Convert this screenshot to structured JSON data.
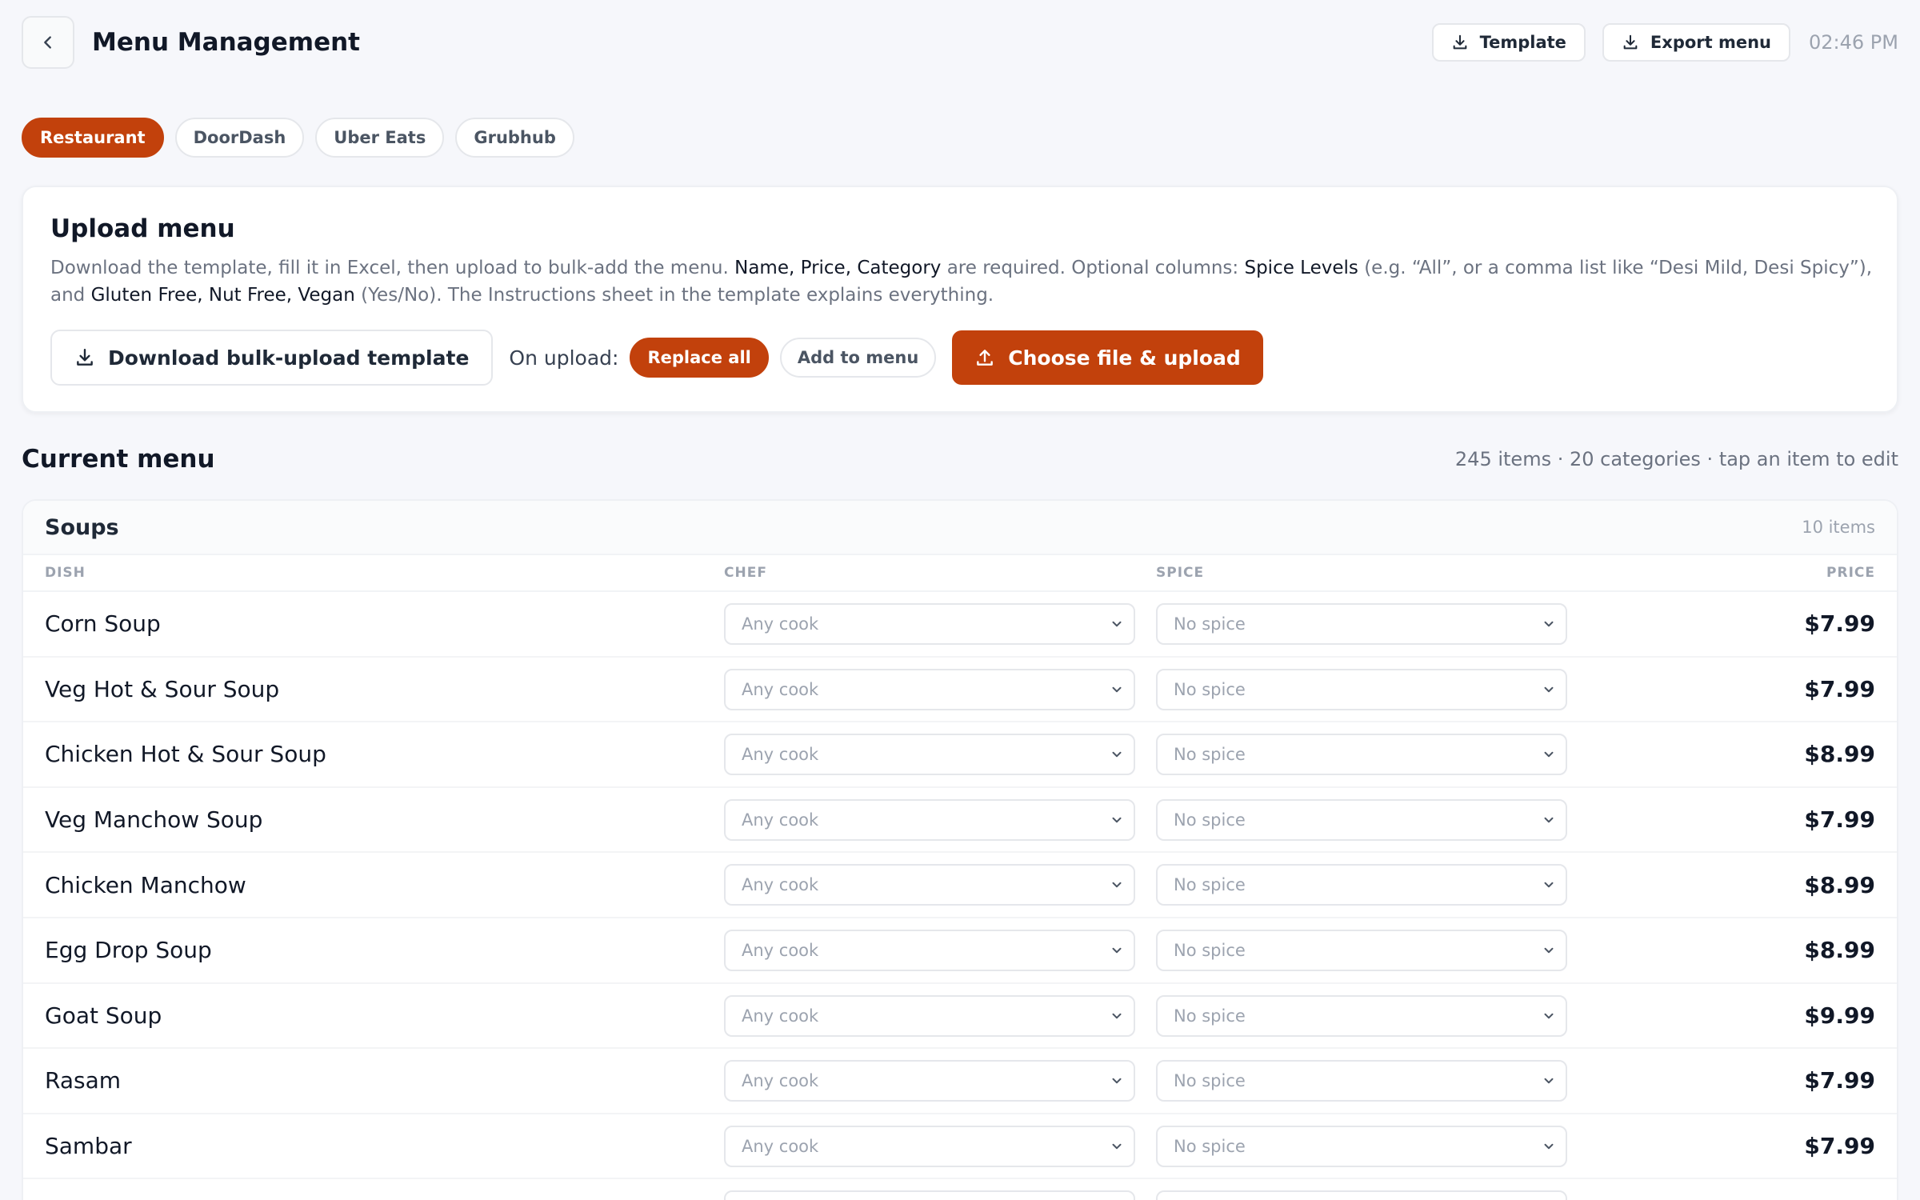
{
  "header": {
    "title": "Menu Management",
    "template_label": "Template",
    "export_label": "Export menu",
    "time": "02:46 PM"
  },
  "tabs": [
    {
      "label": "Restaurant",
      "active": true
    },
    {
      "label": "DoorDash",
      "active": false
    },
    {
      "label": "Uber Eats",
      "active": false
    },
    {
      "label": "Grubhub",
      "active": false
    }
  ],
  "upload": {
    "title": "Upload menu",
    "desc_1": "Download the template, fill it in Excel, then upload to bulk-add the menu. ",
    "desc_required": "Name, Price, Category",
    "desc_2": " are required. Optional columns: ",
    "desc_spice": "Spice Levels",
    "desc_3": " (e.g. “All”, or a comma list like “Desi Mild, Desi Spicy”), and ",
    "desc_flags": "Gluten Free, Nut Free, Vegan",
    "desc_4": " (Yes/No). The Instructions sheet in the template explains everything.",
    "download_label": "Download bulk-upload template",
    "on_upload_label": "On upload:",
    "replace_label": "Replace all",
    "add_label": "Add to menu",
    "choose_label": "Choose file & upload"
  },
  "current_menu": {
    "title": "Current menu",
    "meta": "245 items · 20 categories · tap an item to edit"
  },
  "category": {
    "name": "Soups",
    "count": "10 items",
    "col_dish": "DISH",
    "col_chef": "CHEF",
    "col_spice": "SPICE",
    "col_price": "PRICE"
  },
  "items": [
    {
      "name": "Corn Soup",
      "chef": "Any cook",
      "spice": "No spice",
      "price": "$7.99"
    },
    {
      "name": "Veg Hot & Sour Soup",
      "chef": "Any cook",
      "spice": "No spice",
      "price": "$7.99"
    },
    {
      "name": "Chicken Hot & Sour Soup",
      "chef": "Any cook",
      "spice": "No spice",
      "price": "$8.99"
    },
    {
      "name": "Veg Manchow Soup",
      "chef": "Any cook",
      "spice": "No spice",
      "price": "$7.99"
    },
    {
      "name": "Chicken Manchow",
      "chef": "Any cook",
      "spice": "No spice",
      "price": "$8.99"
    },
    {
      "name": "Egg Drop Soup",
      "chef": "Any cook",
      "spice": "No spice",
      "price": "$8.99"
    },
    {
      "name": "Goat Soup",
      "chef": "Any cook",
      "spice": "No spice",
      "price": "$9.99"
    },
    {
      "name": "Rasam",
      "chef": "Any cook",
      "spice": "No spice",
      "price": "$7.99"
    },
    {
      "name": "Sambar",
      "chef": "Any cook",
      "spice": "No spice",
      "price": "$7.99"
    }
  ],
  "colors": {
    "accent": "#c2410c",
    "background": "#f6f7fb"
  }
}
